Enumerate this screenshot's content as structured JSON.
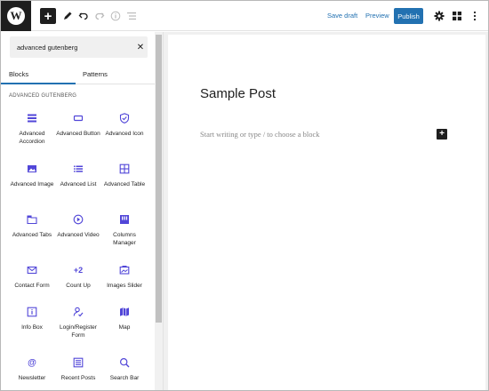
{
  "header": {
    "logo_letter": "W",
    "save_draft": "Save draft",
    "preview": "Preview",
    "publish": "Publish"
  },
  "sidebar": {
    "search_value": "advanced gutenberg",
    "tabs": [
      "Blocks",
      "Patterns"
    ],
    "category": "ADVANCED GUTENBERG",
    "blocks": [
      {
        "label": "Advanced Accordion",
        "icon": "accordion-icon"
      },
      {
        "label": "Advanced Button",
        "icon": "button-icon"
      },
      {
        "label": "Advanced Icon",
        "icon": "shield-icon"
      },
      {
        "label": "Advanced Image",
        "icon": "image-icon"
      },
      {
        "label": "Advanced List",
        "icon": "list-icon"
      },
      {
        "label": "Advanced Table",
        "icon": "table-icon"
      },
      {
        "label": "Advanced Tabs",
        "icon": "tabs-icon"
      },
      {
        "label": "Advanced Video",
        "icon": "video-icon"
      },
      {
        "label": "Columns Manager",
        "icon": "columns-icon"
      },
      {
        "label": "Contact Form",
        "icon": "mail-icon"
      },
      {
        "label": "Count Up",
        "icon": "count-up-icon"
      },
      {
        "label": "Images Slider",
        "icon": "slider-icon"
      },
      {
        "label": "Info Box",
        "icon": "info-icon"
      },
      {
        "label": "Login/Register Form",
        "icon": "login-icon"
      },
      {
        "label": "Map",
        "icon": "map-icon"
      },
      {
        "label": "Newsletter",
        "icon": "at-icon"
      },
      {
        "label": "Recent Posts",
        "icon": "posts-icon"
      },
      {
        "label": "Search Bar",
        "icon": "search-icon"
      }
    ]
  },
  "editor": {
    "post_title": "Sample Post",
    "placeholder": "Start writing or type / to choose a block"
  },
  "colors": {
    "accent": "#2271b1",
    "icon_purple": "#5146d8",
    "dark": "#1e1e1e"
  }
}
